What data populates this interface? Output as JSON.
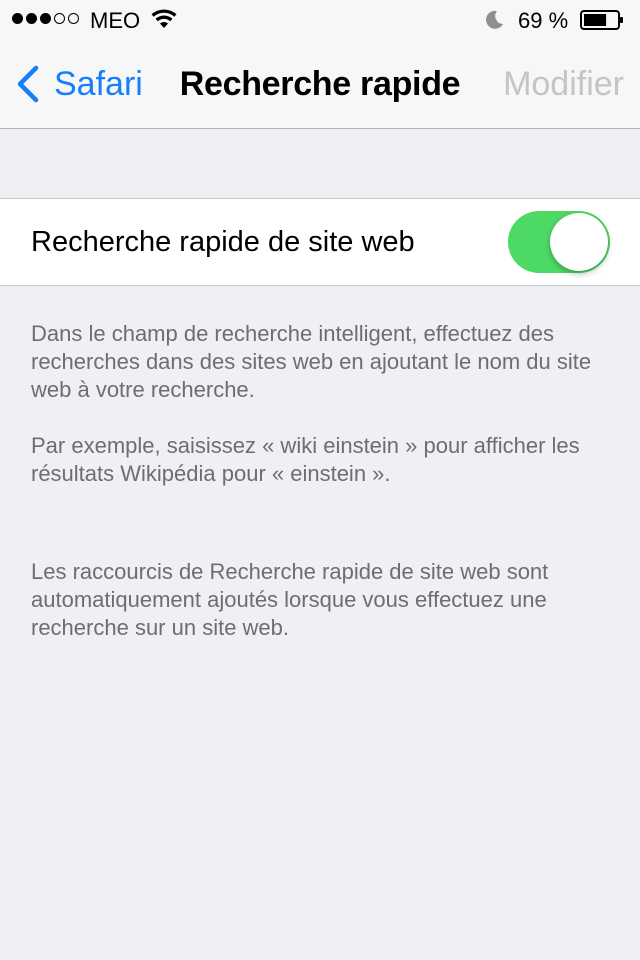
{
  "status_bar": {
    "signal_filled": 3,
    "signal_total": 5,
    "carrier": "MEO",
    "battery_percent": "69 %",
    "battery_level": 0.69,
    "icons": [
      "signal-dots",
      "wifi-icon",
      "moon-icon",
      "battery-icon"
    ]
  },
  "nav": {
    "back_label": "Safari",
    "title": "Recherche rapide",
    "action_label": "Modifier",
    "action_enabled": false
  },
  "settings": {
    "toggle_label": "Recherche rapide de site web",
    "toggle_on": true,
    "toggle_color": "#4cd964"
  },
  "footer": {
    "description": "Dans le champ de recherche intelligent, effectuez des recherches dans des sites web en ajoutant le nom du site web à votre recherche.",
    "example": "Par exemple, saisissez « wiki einstein » pour afficher les résultats Wikipédia pour « einstein ».",
    "shortcuts_note": "Les raccourcis de Recherche rapide de site web sont automatiquement ajoutés lorsque vous effectuez une recherche sur un site web."
  },
  "colors": {
    "accent": "#157efb",
    "background": "#efeff4",
    "disabled": "#c4c4c9",
    "footer_text": "#6d6d72"
  }
}
